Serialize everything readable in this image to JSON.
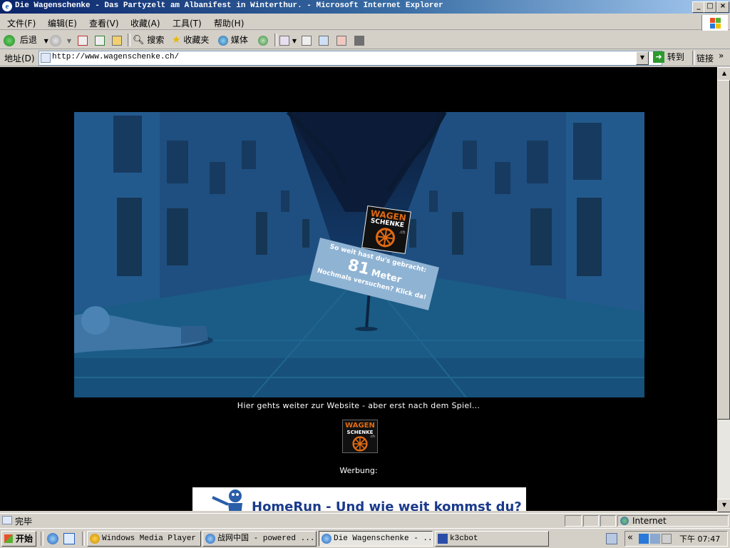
{
  "window": {
    "title": "Die Wagenschenke - Das Partyzelt am Albanifest in Winterthur. - Microsoft Internet Explorer",
    "controls": [
      "_",
      "□",
      "×"
    ]
  },
  "menu": [
    "文件(F)",
    "编辑(E)",
    "查看(V)",
    "收藏(A)",
    "工具(T)",
    "帮助(H)"
  ],
  "toolbar": {
    "back": "后退",
    "search": "搜索",
    "favorites": "收藏夹",
    "media": "媒体"
  },
  "address": {
    "label": "地址(D)",
    "url": "http://www.wagenschenke.ch/",
    "go": "转到",
    "links": "链接"
  },
  "page": {
    "game": {
      "logo_line1": "WAGEN",
      "logo_line2": "SCHENKE",
      "logo_suffix": ".ch",
      "sign_line1": "So weit hast du's gebracht:",
      "distance": "81",
      "unit": "Meter",
      "sign_line3": "Nochmals versuchen? Klick da!"
    },
    "caption": "Hier gehts weiter zur Website - aber erst nach dem Spiel...",
    "small_logo_line1": "WAGEN",
    "small_logo_line2": "SCHENKE",
    "small_logo_suffix": ".ch",
    "werbung": "Werbung:",
    "ad_text": "HomeRun - Und wie weit kommst du?"
  },
  "status": {
    "text": "完毕",
    "zone": "Internet"
  },
  "taskbar": {
    "start": "开始",
    "tasks": [
      "Windows Media Player",
      "战网中国 - powered ...",
      "Die Wagenschenke - ...",
      "k3cbot"
    ],
    "clock": "下午 07:47",
    "tray_chevron": "«"
  },
  "colors": {
    "titlebar": "#0a246a",
    "sky": "#0c1e3c",
    "street": "#16507c",
    "sign": "#8fb3d3",
    "logo_orange": "#e06a12"
  }
}
